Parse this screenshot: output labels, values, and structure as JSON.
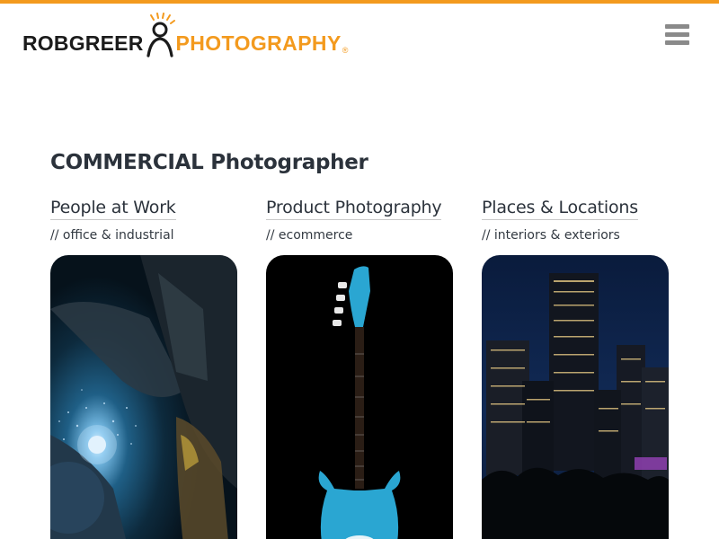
{
  "header": {
    "logo": {
      "left_text": "ROBGREER",
      "right_text": "PHOTOGRAPHY",
      "registered": "®"
    },
    "menu_icon": "hamburger-icon"
  },
  "colors": {
    "accent": "#f39a1e",
    "heading": "#2b323b",
    "menu_icon": "#8a8a8a"
  },
  "main": {
    "heading": "COMMERCIAL Photographer",
    "categories": [
      {
        "title": "People at Work",
        "subtitle": "// office & industrial",
        "image": "welder-photo"
      },
      {
        "title": "Product Photography",
        "subtitle": "// ecommerce",
        "image": "bass-guitar-photo"
      },
      {
        "title": "Places & Locations",
        "subtitle": "// interiors & exteriors",
        "image": "city-skyline-photo"
      }
    ]
  }
}
